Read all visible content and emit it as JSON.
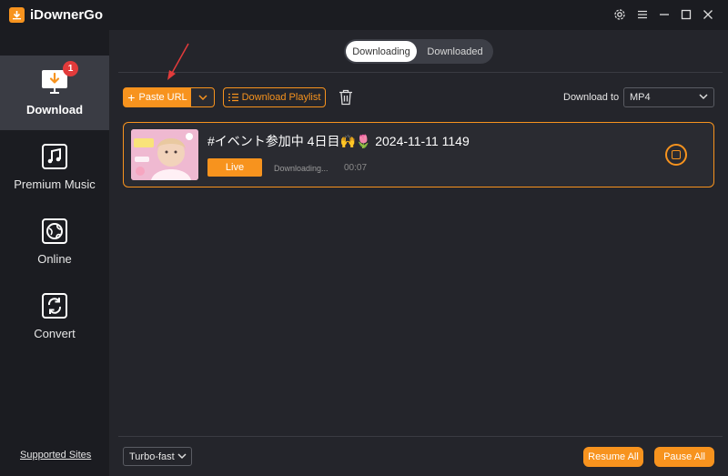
{
  "app": {
    "title": "iDownerGo"
  },
  "sidebar": {
    "items": [
      {
        "label": "Download",
        "badge": "1",
        "icon": "download-monitor-icon",
        "active": true
      },
      {
        "label": "Premium Music",
        "icon": "music-note-icon"
      },
      {
        "label": "Online",
        "icon": "globe-icon"
      },
      {
        "label": "Convert",
        "icon": "convert-icon"
      }
    ],
    "supported_sites": "Supported Sites"
  },
  "tabs": {
    "active": "Downloading",
    "inactive": "Downloaded"
  },
  "toolbar": {
    "paste_url": "Paste URL",
    "download_playlist": "Download Playlist",
    "download_to_label": "Download to",
    "format": "MP4"
  },
  "task": {
    "title": "#イベント参加中 4日目🙌🌷 2024-11-11 1149",
    "live_label": "Live",
    "status": "Downloading...",
    "elapsed": "00:07"
  },
  "footer": {
    "speed_mode": "Turbo-fast",
    "resume_all": "Resume All",
    "pause_all": "Pause All"
  },
  "colors": {
    "accent": "#f7931e",
    "background": "#24252b",
    "sidebar": "#1b1c21",
    "badge": "#e23b3b"
  }
}
